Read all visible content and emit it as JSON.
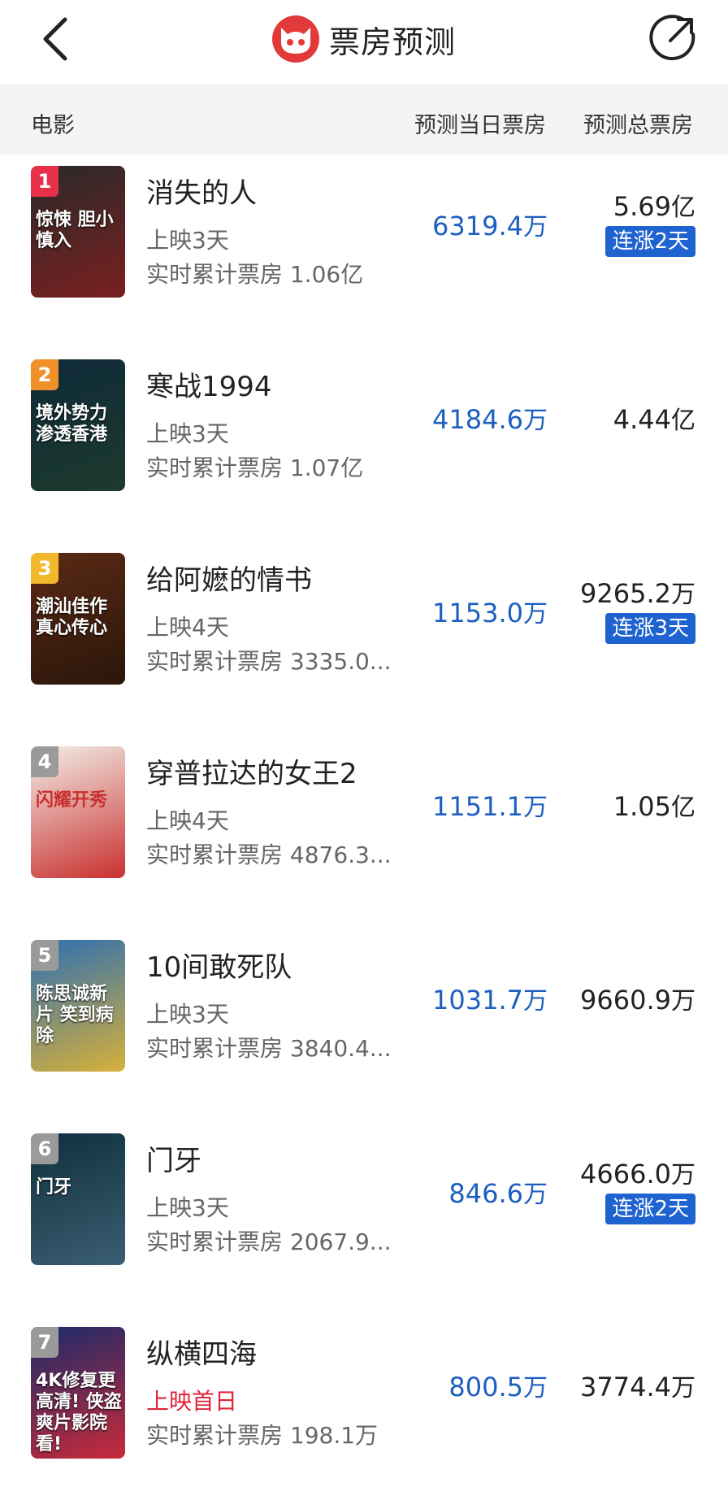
{
  "header": {
    "title": "票房预测"
  },
  "table": {
    "col_movie": "电影",
    "col_today": "预测当日票房",
    "col_total": "预测总票房"
  },
  "movies": [
    {
      "rank": "1",
      "name": "消失的人",
      "days": "上映3天",
      "cum": "实时累计票房 1.06亿",
      "today": "6319.4",
      "today_unit": "万",
      "total": "5.69",
      "total_unit": "亿",
      "badge": "连涨2天",
      "rank_color": "#e8304a",
      "poster_colors": [
        "#2a2a2a",
        "#7a1f1f"
      ],
      "poster_text": "惊悚 胆小慎入"
    },
    {
      "rank": "2",
      "name": "寒战1994",
      "days": "上映3天",
      "cum": "实时累计票房 1.07亿",
      "today": "4184.6",
      "today_unit": "万",
      "total": "4.44",
      "total_unit": "亿",
      "badge": "",
      "rank_color": "#f0902a",
      "poster_colors": [
        "#0f2a3a",
        "#1c3a2c"
      ],
      "poster_text": "境外势力 渗透香港"
    },
    {
      "rank": "3",
      "name": "给阿嬷的情书",
      "days": "上映4天",
      "cum": "实时累计票房 3335.0...",
      "today": "1153.0",
      "today_unit": "万",
      "total": "9265.2",
      "total_unit": "万",
      "badge": "连涨3天",
      "rank_color": "#f0b82a",
      "poster_colors": [
        "#5a2a14",
        "#2a160a"
      ],
      "poster_text": "潮汕佳作 真心传心"
    },
    {
      "rank": "4",
      "name": "穿普拉达的女王2",
      "days": "上映4天",
      "cum": "实时累计票房 4876.3...",
      "today": "1151.1",
      "today_unit": "万",
      "total": "1.05",
      "total_unit": "亿",
      "badge": "",
      "rank_color": "#9a9a9a",
      "poster_colors": [
        "#f3efe8",
        "#c9302f"
      ],
      "poster_text": "闪耀开秀"
    },
    {
      "rank": "5",
      "name": "10间敢死队",
      "days": "上映3天",
      "cum": "实时累计票房 3840.4...",
      "today": "1031.7",
      "today_unit": "万",
      "total": "9660.9",
      "total_unit": "万",
      "badge": "",
      "rank_color": "#9a9a9a",
      "poster_colors": [
        "#2c6fb2",
        "#d8b03a"
      ],
      "poster_text": "陈思诚新片 笑到病除"
    },
    {
      "rank": "6",
      "name": "门牙",
      "days": "上映3天",
      "cum": "实时累计票房 2067.9...",
      "today": "846.6",
      "today_unit": "万",
      "total": "4666.0",
      "total_unit": "万",
      "badge": "连涨2天",
      "rank_color": "#9a9a9a",
      "poster_colors": [
        "#0f2f3c",
        "#3a5f72"
      ],
      "poster_text": "门牙"
    },
    {
      "rank": "7",
      "name": "纵横四海",
      "days": "上映首日",
      "cum": "实时累计票房 198.1万",
      "today": "800.5",
      "today_unit": "万",
      "total": "3774.4",
      "total_unit": "万",
      "badge": "",
      "rank_color": "#9a9a9a",
      "poster_colors": [
        "#1a2a6a",
        "#c92a3a"
      ],
      "poster_text": "4K修复更高清! 侠盗爽片影院看!"
    }
  ]
}
